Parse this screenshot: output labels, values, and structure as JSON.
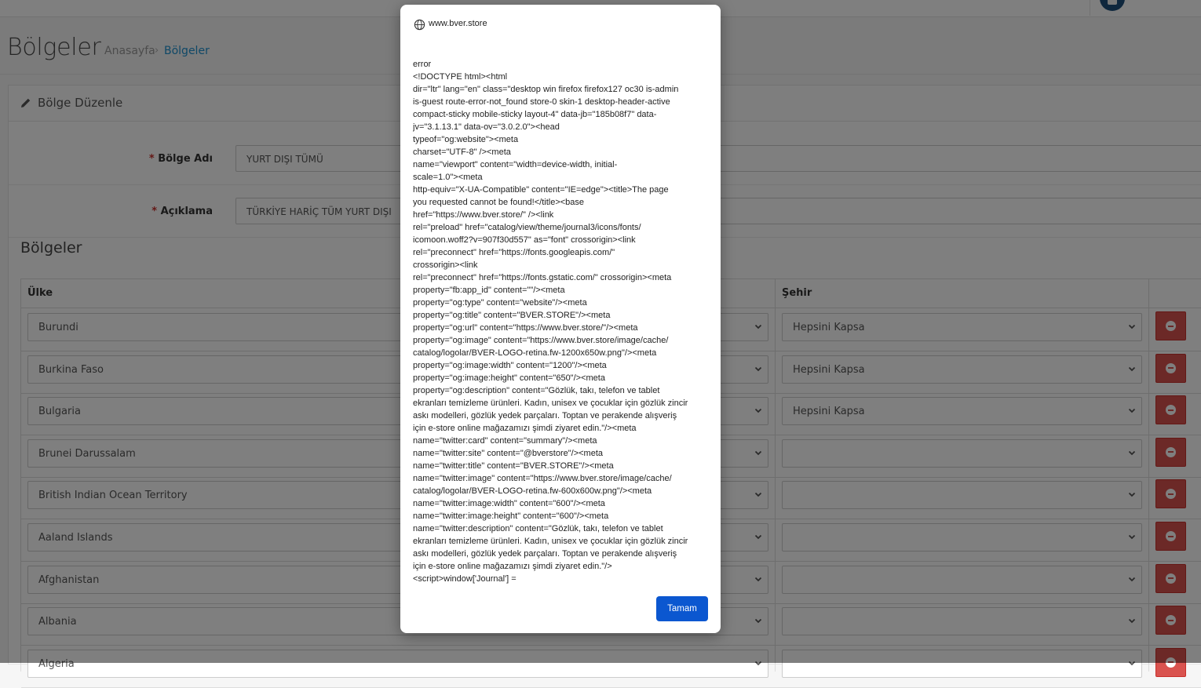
{
  "header": {
    "title": "Bölgeler",
    "breadcrumb": {
      "home": "Anasayfa",
      "separator": "›",
      "current": "Bölgeler"
    }
  },
  "panel": {
    "title": "Bölge Düzenle",
    "fields": {
      "name": {
        "required_mark": "*",
        "label": "Bölge Adı",
        "value": "YURT DIŞI TÜMÜ"
      },
      "description": {
        "required_mark": "*",
        "label": "Açıklama",
        "value": "TÜRKİYE HARİÇ TÜM YURT DIŞI"
      }
    }
  },
  "zones": {
    "section_title": "Bölgeler",
    "columns": {
      "country": "Ülke",
      "city": "Şehir"
    },
    "rows": [
      {
        "country": "Burundi",
        "city": "Hepsini Kapsa"
      },
      {
        "country": "Burkina Faso",
        "city": "Hepsini Kapsa"
      },
      {
        "country": "Bulgaria",
        "city": "Hepsini Kapsa"
      },
      {
        "country": "Brunei Darussalam",
        "city": ""
      },
      {
        "country": "British Indian Ocean Territory",
        "city": ""
      },
      {
        "country": "Aaland Islands",
        "city": ""
      },
      {
        "country": "Afghanistan",
        "city": ""
      },
      {
        "country": "Albania",
        "city": ""
      },
      {
        "country": "Algeria",
        "city": ""
      }
    ]
  },
  "dialog": {
    "origin": "www.bver.store",
    "message": "error\n<!DOCTYPE html><html\ndir=\"ltr\" lang=\"en\" class=\"desktop win firefox firefox127 oc30 is-admin\nis-guest route-error-not_found store-0 skin-1 desktop-header-active\ncompact-sticky mobile-sticky layout-4\" data-jb=\"185b08f7\" data-\njv=\"3.1.13.1\" data-ov=\"3.0.2.0\"><head\ntypeof=\"og:website\"><meta\ncharset=\"UTF-8\" /><meta\nname=\"viewport\" content=\"width=device-width, initial-\nscale=1.0\"><meta\nhttp-equiv=\"X-UA-Compatible\" content=\"IE=edge\"><title>The page\nyou requested cannot be found!</title><base\nhref=\"https://www.bver.store/\" /><link\nrel=\"preload\" href=\"catalog/view/theme/journal3/icons/fonts/\nicomoon.woff2?v=907f30d557\" as=\"font\" crossorigin><link\nrel=\"preconnect\" href=\"https://fonts.googleapis.com/\"\ncrossorigin><link\nrel=\"preconnect\" href=\"https://fonts.gstatic.com/\" crossorigin><meta\nproperty=\"fb:app_id\" content=\"\"/><meta\nproperty=\"og:type\" content=\"website\"/><meta\nproperty=\"og:title\" content=\"BVER.STORE\"/><meta\nproperty=\"og:url\" content=\"https://www.bver.store/\"/><meta\nproperty=\"og:image\" content=\"https://www.bver.store/image/cache/\ncatalog/logolar/BVER-LOGO-retina.fw-1200x650w.png\"/><meta\nproperty=\"og:image:width\" content=\"1200\"/><meta\nproperty=\"og:image:height\" content=\"650\"/><meta\nproperty=\"og:description\" content=\"Gözlük, takı, telefon ve tablet\nekranları temizleme ürünleri. Kadın, unisex ve çocuklar için gözlük zincir\naskı modelleri, gözlük yedek parçaları. Toptan ve perakende alışveriş\niçin e-store online mağazamızı şimdi ziyaret edin.\"/><meta\nname=\"twitter:card\" content=\"summary\"/><meta\nname=\"twitter:site\" content=\"@bverstore\"/><meta\nname=\"twitter:title\" content=\"BVER.STORE\"/><meta\nname=\"twitter:image\" content=\"https://www.bver.store/image/cache/\ncatalog/logolar/BVER-LOGO-retina.fw-600x600w.png\"/><meta\nname=\"twitter:image:width\" content=\"600\"/><meta\nname=\"twitter:image:height\" content=\"600\"/><meta\nname=\"twitter:description\" content=\"Gözlük, takı, telefon ve tablet\nekranları temizleme ürünleri. Kadın, unisex ve çocuklar için gözlük zincir\naskı modelleri, gözlük yedek parçaları. Toptan ve perakende alışveriş\niçin e-store online mağazamızı şimdi ziyaret edin.\"/>\n<script>window['Journal'] =",
    "ok_label": "Tamam"
  },
  "colors": {
    "accent": "#1e91cf",
    "danger": "#d9534f",
    "dialog_button": "#0b57d0"
  }
}
